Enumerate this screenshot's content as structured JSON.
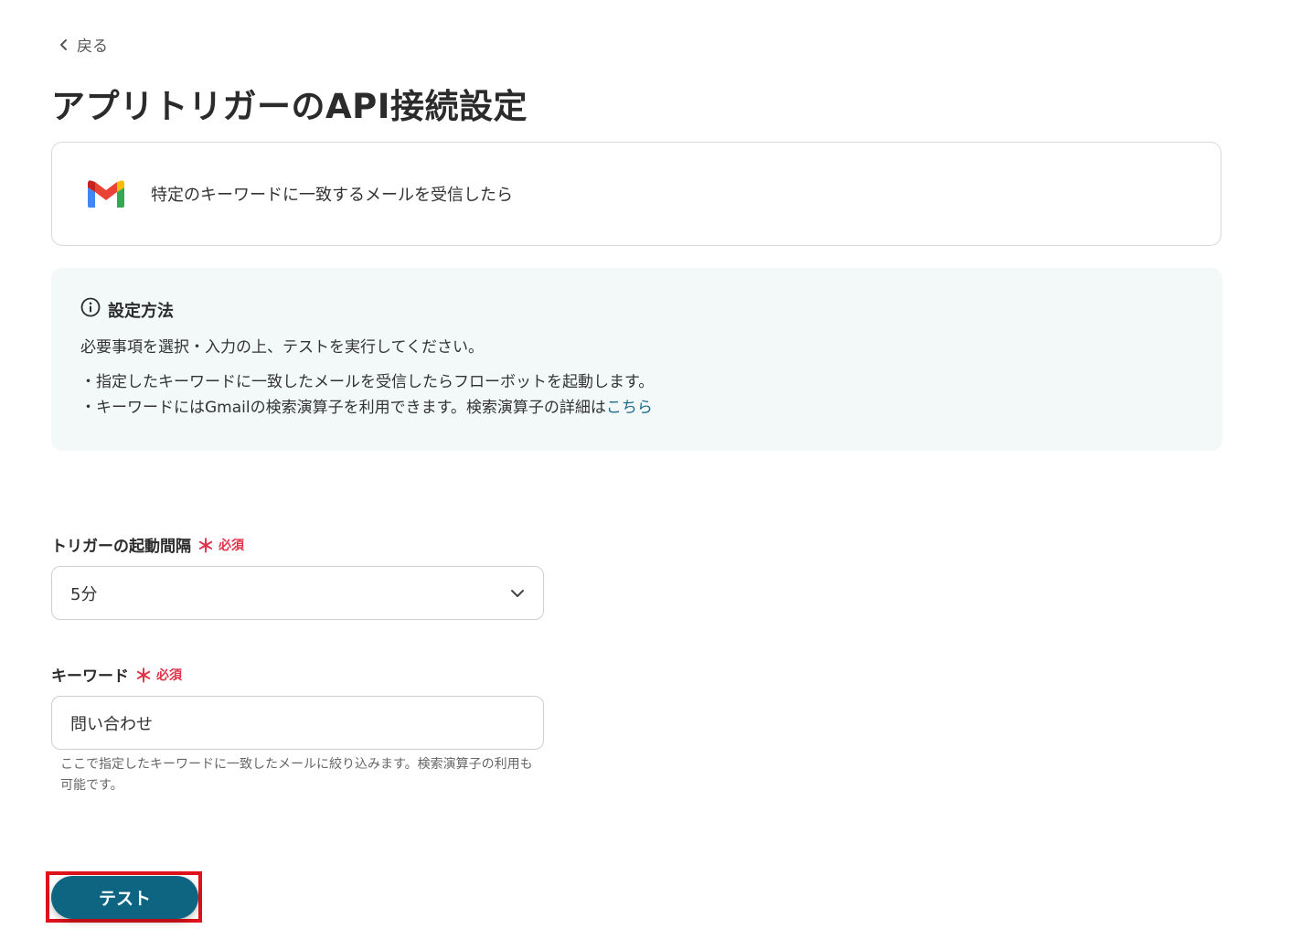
{
  "nav": {
    "back_label": "戻る"
  },
  "page_title": "アプリトリガーのAPI接続設定",
  "app_card": {
    "description": "特定のキーワードに一致するメールを受信したら"
  },
  "info_box": {
    "title": "設定方法",
    "intro": "必要事項を選択・入力の上、テストを実行してください。",
    "bullet_1": "・指定したキーワードに一致したメールを受信したらフローボットを起動します。",
    "bullet_2_prefix": "・キーワードにはGmailの検索演算子を利用できます。検索演算子の詳細は",
    "bullet_2_link": "こちら"
  },
  "fields": {
    "interval": {
      "label": "トリガーの起動間隔",
      "required_star": "＊",
      "required_text": "必須",
      "selected_value": "5分"
    },
    "keyword": {
      "label": "キーワード",
      "required_star": "＊",
      "required_text": "必須",
      "value": "問い合わせ",
      "help": "ここで指定したキーワードに一致したメールに絞り込みます。検索演算子の利用も可能です。"
    }
  },
  "actions": {
    "test_label": "テスト"
  },
  "colors": {
    "accent": "#0e6582",
    "link": "#1b6b8a",
    "required": "#e0334a",
    "info_bg": "#f2f9f8",
    "highlight": "#e0121b"
  }
}
